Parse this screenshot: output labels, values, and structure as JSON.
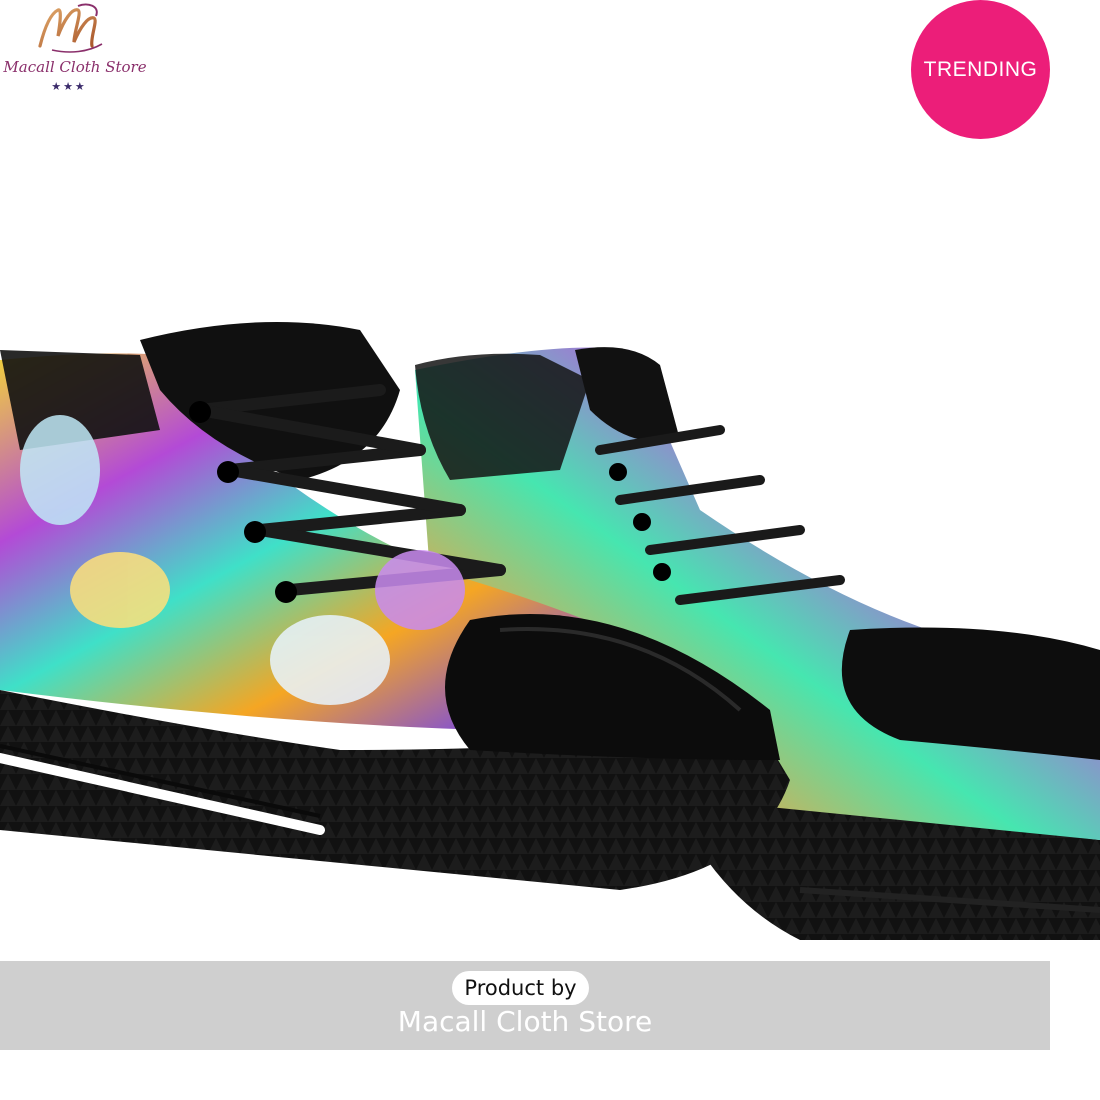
{
  "logo": {
    "name": "Macall Cloth Store",
    "stars": "★★★",
    "accent_color": "#8a2f6b"
  },
  "badge": {
    "label": "TRENDING",
    "color": "#ec1e79"
  },
  "product_image": {
    "icon": "sneakers-photo"
  },
  "banner": {
    "product_by": "Product by",
    "store_name": "Macall Cloth Store",
    "background_color": "#cfcfcf"
  }
}
